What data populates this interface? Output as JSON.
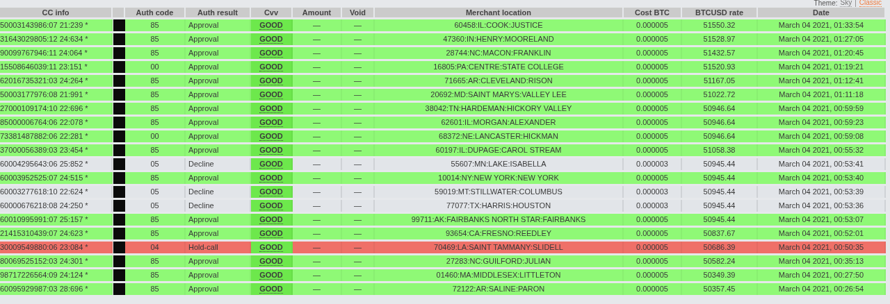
{
  "theme_switch": {
    "label": "Theme:",
    "separator": "|",
    "options": [
      {
        "label": "Sky",
        "selected": false
      },
      {
        "label": "Classic",
        "selected": true
      }
    ]
  },
  "table": {
    "columns": [
      "CC info",
      "Auth code",
      "Auth result",
      "Cvv",
      "Amount",
      "Void",
      "Merchant location",
      "Cost BTC",
      "BTCUSD rate",
      "Date"
    ],
    "rows": [
      {
        "kind": "approval",
        "cc_info": "50003143986:07 21:239 *",
        "auth_code": "85",
        "auth_result": "Approval",
        "cvv": "GOOD",
        "amount": "—",
        "void": "—",
        "merchant_location": "60458:IL:COOK:JUSTICE",
        "cost_btc": "0.000005",
        "btcusd_rate": "51550.32",
        "date": "March 04 2021, 01:33:54"
      },
      {
        "kind": "approval",
        "cc_info": "31643029805:12 24:634 *",
        "auth_code": "85",
        "auth_result": "Approval",
        "cvv": "GOOD",
        "amount": "—",
        "void": "—",
        "merchant_location": "47360:IN:HENRY:MOORELAND",
        "cost_btc": "0.000005",
        "btcusd_rate": "51528.97",
        "date": "March 04 2021, 01:27:05"
      },
      {
        "kind": "approval",
        "cc_info": "90099767946:11 24:064 *",
        "auth_code": "85",
        "auth_result": "Approval",
        "cvv": "GOOD",
        "amount": "—",
        "void": "—",
        "merchant_location": "28744:NC:MACON:FRANKLIN",
        "cost_btc": "0.000005",
        "btcusd_rate": "51432.57",
        "date": "March 04 2021, 01:20:45"
      },
      {
        "kind": "approval",
        "cc_info": "15508646039:11 23:151 *",
        "auth_code": "00",
        "auth_result": "Approval",
        "cvv": "GOOD",
        "amount": "—",
        "void": "—",
        "merchant_location": "16805:PA:CENTRE:STATE COLLEGE",
        "cost_btc": "0.000005",
        "btcusd_rate": "51520.93",
        "date": "March 04 2021, 01:19:21"
      },
      {
        "kind": "approval",
        "cc_info": "62016735321:03 24:264 *",
        "auth_code": "85",
        "auth_result": "Approval",
        "cvv": "GOOD",
        "amount": "—",
        "void": "—",
        "merchant_location": "71665:AR:CLEVELAND:RISON",
        "cost_btc": "0.000005",
        "btcusd_rate": "51167.05",
        "date": "March 04 2021, 01:12:41"
      },
      {
        "kind": "approval",
        "cc_info": "50003177976:08 21:991 *",
        "auth_code": "85",
        "auth_result": "Approval",
        "cvv": "GOOD",
        "amount": "—",
        "void": "—",
        "merchant_location": "20692:MD:SAINT MARYS:VALLEY LEE",
        "cost_btc": "0.000005",
        "btcusd_rate": "51022.72",
        "date": "March 04 2021, 01:11:18"
      },
      {
        "kind": "approval",
        "cc_info": "27000109174:10 22:696 *",
        "auth_code": "85",
        "auth_result": "Approval",
        "cvv": "GOOD",
        "amount": "—",
        "void": "—",
        "merchant_location": "38042:TN:HARDEMAN:HICKORY VALLEY",
        "cost_btc": "0.000005",
        "btcusd_rate": "50946.64",
        "date": "March 04 2021, 00:59:59"
      },
      {
        "kind": "approval",
        "cc_info": "85000006764:06 22:078 *",
        "auth_code": "85",
        "auth_result": "Approval",
        "cvv": "GOOD",
        "amount": "—",
        "void": "—",
        "merchant_location": "62601:IL:MORGAN:ALEXANDER",
        "cost_btc": "0.000005",
        "btcusd_rate": "50946.64",
        "date": "March 04 2021, 00:59:23"
      },
      {
        "kind": "approval",
        "cc_info": "73381487882:06 22:281 *",
        "auth_code": "00",
        "auth_result": "Approval",
        "cvv": "GOOD",
        "amount": "—",
        "void": "—",
        "merchant_location": "68372:NE:LANCASTER:HICKMAN",
        "cost_btc": "0.000005",
        "btcusd_rate": "50946.64",
        "date": "March 04 2021, 00:59:08"
      },
      {
        "kind": "approval",
        "cc_info": "37000056389:03 23:454 *",
        "auth_code": "85",
        "auth_result": "Approval",
        "cvv": "GOOD",
        "amount": "—",
        "void": "—",
        "merchant_location": "60197:IL:DUPAGE:CAROL STREAM",
        "cost_btc": "0.000005",
        "btcusd_rate": "51058.38",
        "date": "March 04 2021, 00:55:32"
      },
      {
        "kind": "decline",
        "cc_info": "60004295643:06 25:852 *",
        "auth_code": "05",
        "auth_result": "Decline",
        "cvv": "GOOD",
        "amount": "—",
        "void": "—",
        "merchant_location": "55607:MN:LAKE:ISABELLA",
        "cost_btc": "0.000003",
        "btcusd_rate": "50945.44",
        "date": "March 04 2021, 00:53:41"
      },
      {
        "kind": "approval",
        "cc_info": "60003952525:07 24:515 *",
        "auth_code": "85",
        "auth_result": "Approval",
        "cvv": "GOOD",
        "amount": "—",
        "void": "—",
        "merchant_location": "10014:NY:NEW YORK:NEW YORK",
        "cost_btc": "0.000005",
        "btcusd_rate": "50945.44",
        "date": "March 04 2021, 00:53:40"
      },
      {
        "kind": "decline",
        "cc_info": "60003277618:10 22:624 *",
        "auth_code": "05",
        "auth_result": "Decline",
        "cvv": "GOOD",
        "amount": "—",
        "void": "—",
        "merchant_location": "59019:MT:STILLWATER:COLUMBUS",
        "cost_btc": "0.000003",
        "btcusd_rate": "50945.44",
        "date": "March 04 2021, 00:53:39"
      },
      {
        "kind": "decline",
        "cc_info": "60000676218:08 24:250 *",
        "auth_code": "05",
        "auth_result": "Decline",
        "cvv": "GOOD",
        "amount": "—",
        "void": "—",
        "merchant_location": "77077:TX:HARRIS:HOUSTON",
        "cost_btc": "0.000003",
        "btcusd_rate": "50945.44",
        "date": "March 04 2021, 00:53:36"
      },
      {
        "kind": "approval",
        "cc_info": "60010995991:07 25:157 *",
        "auth_code": "85",
        "auth_result": "Approval",
        "cvv": "GOOD",
        "amount": "—",
        "void": "—",
        "merchant_location": "99711:AK:FAIRBANKS NORTH STAR:FAIRBANKS",
        "cost_btc": "0.000005",
        "btcusd_rate": "50945.44",
        "date": "March 04 2021, 00:53:07"
      },
      {
        "kind": "approval",
        "cc_info": "21415310439:07 24:623 *",
        "auth_code": "85",
        "auth_result": "Approval",
        "cvv": "GOOD",
        "amount": "—",
        "void": "—",
        "merchant_location": "93654:CA:FRESNO:REEDLEY",
        "cost_btc": "0.000005",
        "btcusd_rate": "50837.67",
        "date": "March 04 2021, 00:52:01"
      },
      {
        "kind": "hold",
        "cc_info": "30009549880:06 23:084 *",
        "auth_code": "04",
        "auth_result": "Hold-call",
        "cvv": "GOOD",
        "amount": "—",
        "void": "—",
        "merchant_location": "70469:LA:SAINT TAMMANY:SLIDELL",
        "cost_btc": "0.000005",
        "btcusd_rate": "50686.39",
        "date": "March 04 2021, 00:50:35"
      },
      {
        "kind": "approval",
        "cc_info": "80069525152:03 24:301 *",
        "auth_code": "85",
        "auth_result": "Approval",
        "cvv": "GOOD",
        "amount": "—",
        "void": "—",
        "merchant_location": "27283:NC:GUILFORD:JULIAN",
        "cost_btc": "0.000005",
        "btcusd_rate": "50582.24",
        "date": "March 04 2021, 00:35:13"
      },
      {
        "kind": "approval",
        "cc_info": "98717226564:09 24:124 *",
        "auth_code": "85",
        "auth_result": "Approval",
        "cvv": "GOOD",
        "amount": "—",
        "void": "—",
        "merchant_location": "01460:MA:MIDDLESEX:LITTLETON",
        "cost_btc": "0.000005",
        "btcusd_rate": "50349.39",
        "date": "March 04 2021, 00:27:50"
      },
      {
        "kind": "approval",
        "cc_info": "60095929987:03 28:696 *",
        "auth_code": "85",
        "auth_result": "Approval",
        "cvv": "GOOD",
        "amount": "—",
        "void": "—",
        "merchant_location": "72122:AR:SALINE:PARON",
        "cost_btc": "0.000005",
        "btcusd_rate": "50357.45",
        "date": "March 04 2021, 00:26:54"
      }
    ]
  }
}
